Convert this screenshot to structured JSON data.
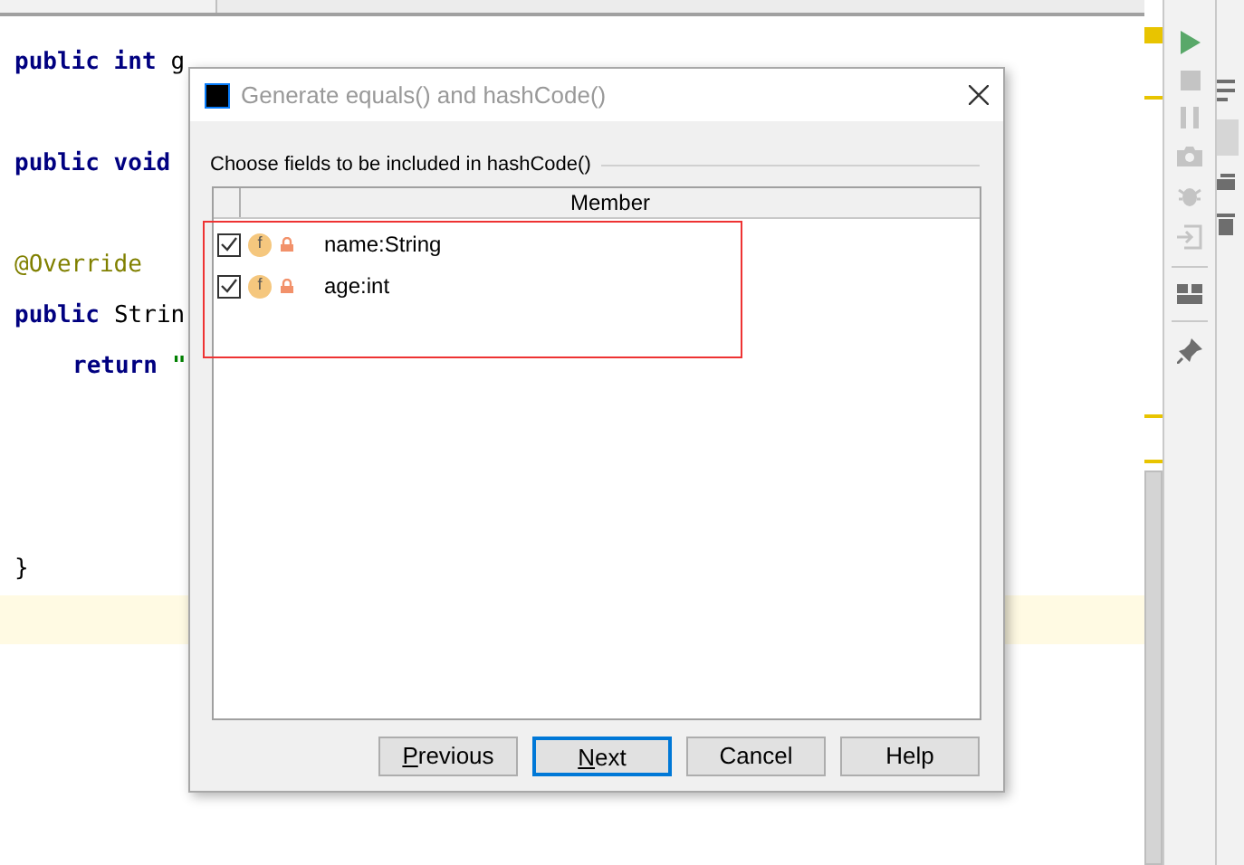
{
  "editor": {
    "lines": [
      {
        "indent": false,
        "tokens": [
          {
            "kind": "keyword",
            "text": "public int"
          },
          {
            "kind": "plain",
            "text": "g"
          }
        ]
      },
      {
        "indent": false,
        "tokens": [
          {
            "kind": "keyword",
            "text": "public void"
          }
        ]
      },
      {
        "indent": false,
        "tokens": [
          {
            "kind": "annotation",
            "text": "@Override"
          }
        ]
      },
      {
        "indent": false,
        "tokens": [
          {
            "kind": "keyword",
            "text": "public"
          },
          {
            "kind": "plain",
            "text": "Strin"
          }
        ]
      },
      {
        "indent": true,
        "tokens": [
          {
            "kind": "keyword",
            "text": "return"
          },
          {
            "kind": "string",
            "text": "\""
          }
        ]
      },
      {
        "indent": false,
        "tokens": [
          {
            "kind": "plain",
            "text": "}"
          }
        ]
      }
    ],
    "current_line": true
  },
  "dialog": {
    "title": "Generate equals() and hashCode()",
    "group_label": "Choose fields to be included in hashCode()",
    "table": {
      "columns": [
        "Member"
      ],
      "rows": [
        {
          "checked": true,
          "badge": "f",
          "name": "name:String"
        },
        {
          "checked": true,
          "badge": "f",
          "name": "age:int"
        }
      ]
    },
    "buttons": [
      {
        "label": "Previous",
        "underline_first": true,
        "default": false
      },
      {
        "label": "Next",
        "underline_first": true,
        "default": true
      },
      {
        "label": "Cancel",
        "underline_first": false,
        "default": false
      },
      {
        "label": "Help",
        "underline_first": false,
        "default": false
      }
    ]
  }
}
